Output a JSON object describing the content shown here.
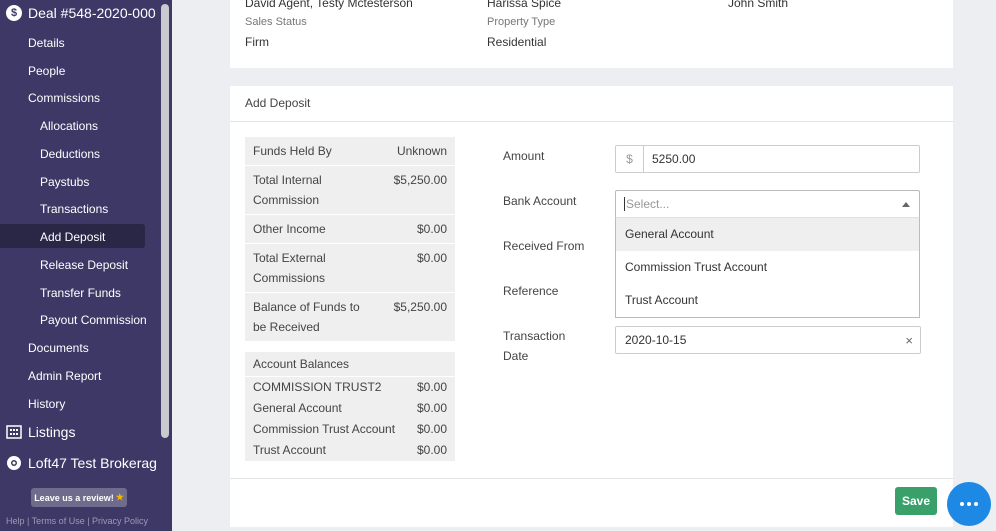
{
  "sidebar": {
    "deal_title": "Deal #548-2020-000",
    "items": [
      {
        "label": "Details"
      },
      {
        "label": "People"
      },
      {
        "label": "Commissions"
      },
      {
        "label": "Allocations"
      },
      {
        "label": "Deductions"
      },
      {
        "label": "Paystubs"
      },
      {
        "label": "Transactions"
      },
      {
        "label": "Add Deposit",
        "active": true
      },
      {
        "label": "Release Deposit"
      },
      {
        "label": "Transfer Funds"
      },
      {
        "label": "Payout Commission"
      },
      {
        "label": "Documents"
      },
      {
        "label": "Admin Report"
      },
      {
        "label": "History"
      }
    ],
    "sections": [
      {
        "label": "Listings",
        "icon": "building-icon"
      },
      {
        "label": "Loft47 Test Brokerag",
        "icon": "gear-icon"
      }
    ],
    "review_label": "Leave us a review!",
    "footer": "Help | Terms of Use | Privacy Policy"
  },
  "deal_info": {
    "row1": [
      "David Agent, Testy Mctesterson",
      "Harissa Spice",
      "John Smith"
    ],
    "sales_status_label": "Sales Status",
    "sales_status_value": "Firm",
    "property_type_label": "Property Type",
    "property_type_value": "Residential"
  },
  "deposit": {
    "title": "Add Deposit",
    "summary": [
      {
        "label": "Funds Held By",
        "value": "Unknown"
      },
      {
        "label": "Total Internal Commission",
        "value": "$5,250.00"
      },
      {
        "label": "Other Income",
        "value": "$0.00"
      },
      {
        "label": "Total External Commissions",
        "value": "$0.00"
      },
      {
        "label": "Balance of Funds to be Received",
        "value": "$5,250.00"
      }
    ],
    "balances_title": "Account Balances",
    "balances": [
      {
        "label": "COMMISSION TRUST2",
        "value": "$0.00"
      },
      {
        "label": "General Account",
        "value": "$0.00"
      },
      {
        "label": "Commission Trust Account",
        "value": "$0.00"
      },
      {
        "label": "Trust Account",
        "value": "$0.00"
      }
    ],
    "form": {
      "amount_label": "Amount",
      "amount_prefix": "$",
      "amount_value": "5250.00",
      "bank_label": "Bank Account",
      "bank_placeholder": "Select...",
      "bank_options": [
        "General Account",
        "Commission Trust Account",
        "Trust Account"
      ],
      "received_from_label": "Received From",
      "reference_label": "Reference",
      "date_label": "Transaction Date",
      "date_value": "2020-10-15",
      "clear_symbol": "×"
    },
    "save_label": "Save"
  }
}
